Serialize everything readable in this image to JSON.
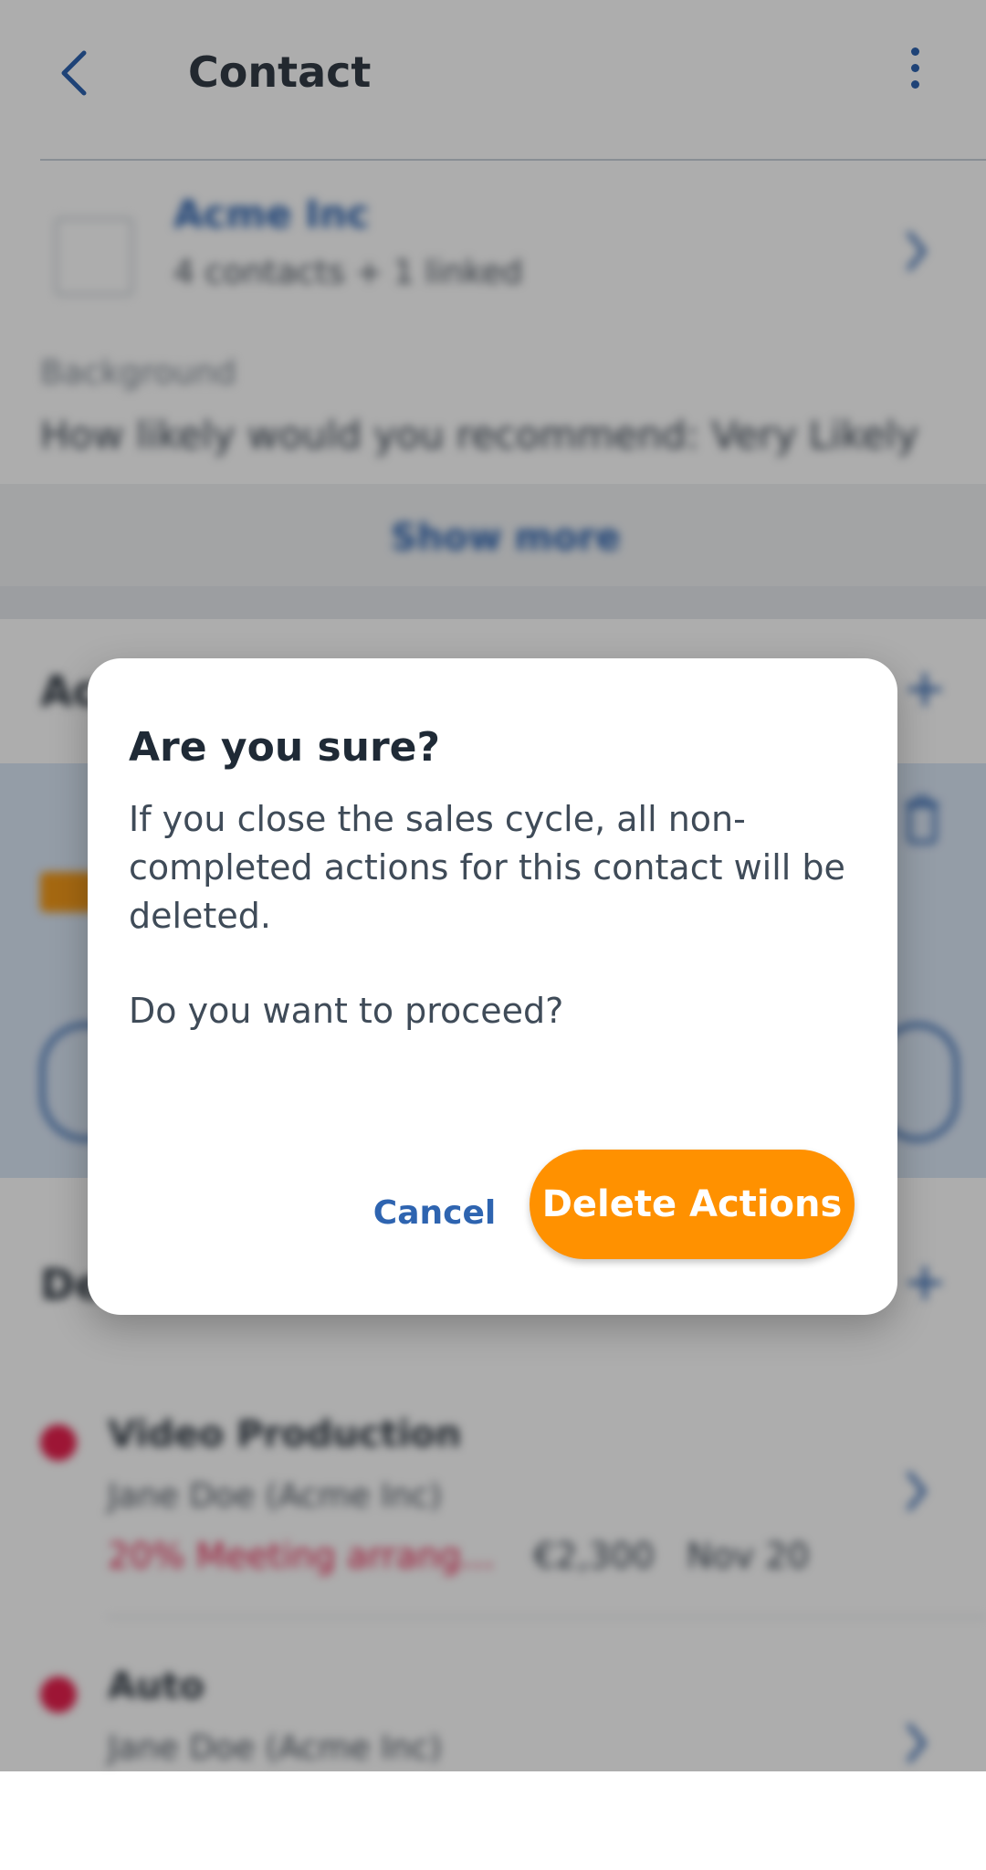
{
  "header": {
    "title": "Contact"
  },
  "company": {
    "name": "Acme Inc",
    "subtitle": "4 contacts + 1 linked"
  },
  "background": {
    "label": "Background",
    "value": "How likely would you recommend: Very Likely"
  },
  "show_more": {
    "label": "Show more"
  },
  "deals": [
    {
      "title": "Video Production",
      "subtitle": "Jane Doe (Acme Inc)",
      "status": "20% Meeting arrang...",
      "amount": "€2,300",
      "date": "Nov 20"
    },
    {
      "title": "Auto",
      "subtitle": "Jane Doe (Acme Inc)"
    }
  ],
  "dialog": {
    "title": "Are you sure?",
    "message": "If you close the sales cycle, all non-completed actions for this contact will be deleted.",
    "question": "Do you want to proceed?",
    "cancel_label": "Cancel",
    "confirm_label": "Delete Actions"
  },
  "colors": {
    "primary": "#2e64b0",
    "accent_orange": "#ff9100",
    "deal_red": "#e7204e"
  }
}
